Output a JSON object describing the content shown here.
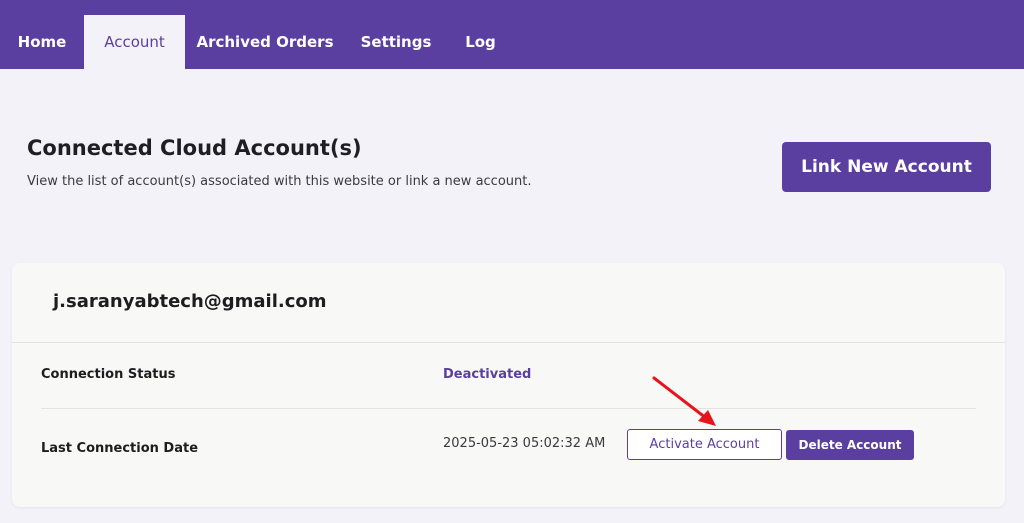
{
  "nav": {
    "tabs": [
      {
        "label": "Home",
        "active": false
      },
      {
        "label": "Account",
        "active": true
      },
      {
        "label": "Archived Orders",
        "active": false
      },
      {
        "label": "Settings",
        "active": false
      },
      {
        "label": "Log",
        "active": false
      }
    ]
  },
  "header": {
    "title": "Connected Cloud Account(s)",
    "subtitle": "View the list of account(s) associated with this website or link a new account.",
    "link_button_label": "Link New Account"
  },
  "account_card": {
    "email": "j.saranyabtech@gmail.com",
    "connection_status_label": "Connection Status",
    "connection_status_value": "Deactivated",
    "last_connection_label": "Last Connection Date",
    "last_connection_value": "2025-05-23 05:02:32 AM",
    "activate_button_label": "Activate Account",
    "delete_button_label": "Delete Account"
  },
  "colors": {
    "brand": "#5b3fa0",
    "background": "#f3f2f8",
    "card": "#f8f8f6",
    "annotation_arrow": "#e8141b"
  },
  "annotation": {
    "icon": "red-arrow-icon"
  }
}
